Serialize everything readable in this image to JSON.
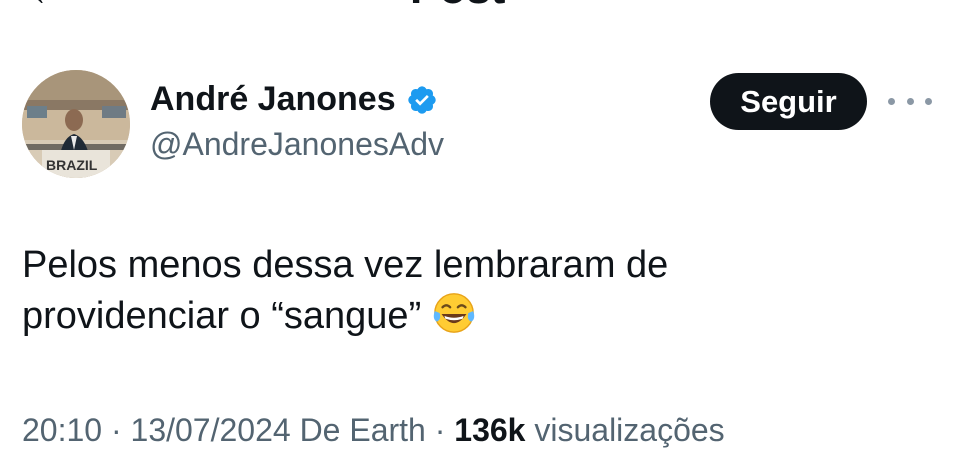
{
  "header": {
    "back_icon": "arrow-left-icon",
    "title": "Post"
  },
  "author": {
    "display_name": "André Janones",
    "handle": "@AndreJanonesAdv",
    "verified_icon": "verified-badge-icon",
    "avatar_label": "BRAZIL"
  },
  "actions": {
    "follow_label": "Seguir",
    "more_icon": "more-options-icon"
  },
  "tweet": {
    "line1": "Pelos menos dessa vez lembraram de",
    "line2": "providenciar o “sangue”",
    "emoji": "face-with-tears-of-joy"
  },
  "meta": {
    "time": "20:10",
    "sep1": " · ",
    "date": "13/07/2024",
    "source": " De Earth",
    "sep2": " · ",
    "views_count": "136k",
    "views_label": " visualizações"
  },
  "colors": {
    "text": "#0f1419",
    "secondary": "#536471",
    "verified": "#1d9bf0",
    "button_bg": "#0f1419",
    "button_text": "#ffffff"
  }
}
